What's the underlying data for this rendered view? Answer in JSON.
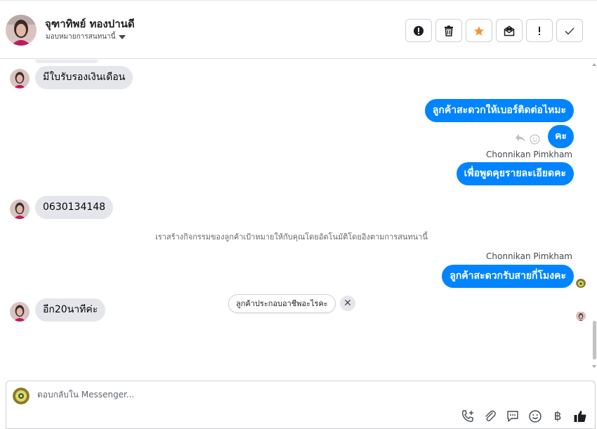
{
  "header": {
    "contact_name": "จุฑาทิพย์ ทองปานดี",
    "assign_label": "มอบหมายการสนทนานี้",
    "actions": [
      "spam-icon",
      "trash-icon",
      "star-icon",
      "mark-unread-icon",
      "important-icon",
      "done-icon"
    ]
  },
  "messages": {
    "m1_text": "มีใบรับรองเงินเดือน",
    "m2_text": "ลูกค้าสะดวกให้เบอร์ติดต่อไหมะ",
    "m3_text": "คะ",
    "m4_sender": "Chonnikan Pimkham",
    "m4_text": "เพื่อพูดคุยรายละเอียดคะ",
    "m5_text": "0630134148",
    "system_note": "เราสร้างกิจกรรมของลูกค้าเป้าหมายให้กับคุณโดยอัตโนมัติโดยอิงตามการสนทนานี้",
    "m6_sender": "Chonnikan Pimkham",
    "m6_text": "ลูกค้าสะดวกรับสายกี่โมงคะ",
    "m7_text": "อีก20นาทีค่ะ"
  },
  "suggestion": {
    "text": "ลูกค้าประกอบอาชีพอะไรคะ",
    "close": "✕"
  },
  "composer": {
    "placeholder": "ตอบกลับใน Messenger...",
    "currency_symbol": "฿"
  },
  "colors": {
    "outgoing_bubble": "#0084ff",
    "incoming_bubble": "#e4e6eb",
    "star": "#f7923b"
  }
}
